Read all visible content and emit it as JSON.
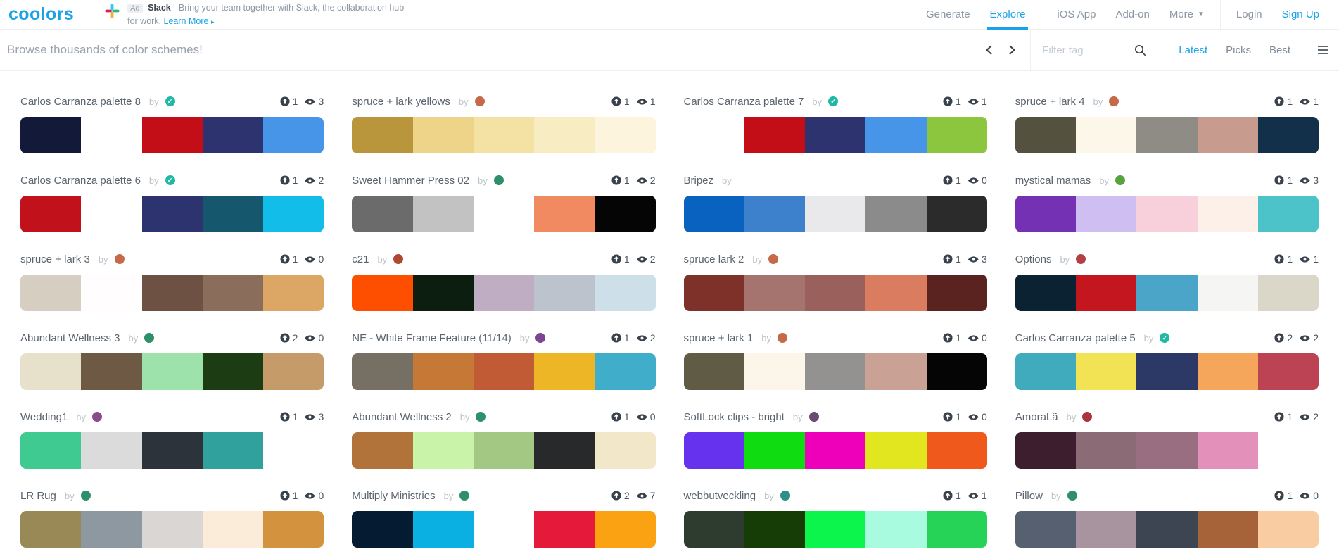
{
  "header": {
    "logo": "coolors",
    "ad": {
      "badge": "Ad",
      "brand": "Slack",
      "text1": "- Bring your team together with Slack, the collaboration hub",
      "text2": "for work.",
      "link_label": "Learn More",
      "link_arrow": "▸"
    },
    "nav": [
      {
        "label": "Generate"
      },
      {
        "label": "Explore",
        "active": true
      },
      {
        "label": "iOS App"
      },
      {
        "label": "Add-on"
      },
      {
        "label": "More",
        "has_caret": true
      },
      {
        "label": "Login"
      },
      {
        "label": "Sign Up",
        "highlight": true
      }
    ]
  },
  "toolbar": {
    "title": "Browse thousands of color schemes!",
    "filter_placeholder": "Filter tag",
    "tabs": [
      {
        "label": "Latest",
        "active": true
      },
      {
        "label": "Picks"
      },
      {
        "label": "Best"
      }
    ]
  },
  "shared": {
    "by_label": "by"
  },
  "icons": {
    "saves": "upload-icon",
    "views": "eye-icon",
    "search": "search-icon",
    "prev": "chevron-left-icon",
    "next": "chevron-right-icon",
    "menu": "hamburger-icon",
    "verified": "check-icon",
    "ad_logo": "slack-icon"
  },
  "colors": {
    "accent_blue": "#19A2E8",
    "verified_teal": "#1FB9A5",
    "icon_dark": "#39424B"
  },
  "palettes": [
    {
      "title": "Carlos Carranza palette 8",
      "verified": true,
      "avatar": "#1FB9A5",
      "saves": "1",
      "views": "3",
      "colors": [
        "#131A39",
        "#FFFFFF",
        "#C30E18",
        "#2D336E",
        "#4795E8"
      ]
    },
    {
      "title": "spruce + lark yellows",
      "verified": false,
      "avatar": "#C56A48",
      "saves": "1",
      "views": "1",
      "colors": [
        "#B9953C",
        "#EDD488",
        "#F3E2A4",
        "#F8ECC3",
        "#FCF4DD"
      ]
    },
    {
      "title": "Carlos Carranza palette 7",
      "verified": true,
      "avatar": "#1FB9A5",
      "saves": "1",
      "views": "1",
      "colors": [
        "#FFFFFF",
        "#C30E18",
        "#2D336E",
        "#4795E8",
        "#8CC63E"
      ]
    },
    {
      "title": "spruce + lark 4",
      "verified": false,
      "avatar": "#C56A48",
      "saves": "1",
      "views": "1",
      "colors": [
        "#55513F",
        "#FDF7EA",
        "#8F8C86",
        "#C79C8E",
        "#12304A"
      ]
    },
    {
      "title": "Carlos Carranza palette 6",
      "verified": true,
      "avatar": "#1FB9A5",
      "saves": "1",
      "views": "2",
      "colors": [
        "#C1121C",
        "#FFFFFF",
        "#2D336E",
        "#15586E",
        "#12BDEA"
      ]
    },
    {
      "title": "Sweet Hammer Press 02",
      "verified": false,
      "avatar": "#2F8F6B",
      "saves": "1",
      "views": "2",
      "colors": [
        "#6B6B6B",
        "#C2C2C2",
        "#FFFFFF",
        "#F18A60",
        "#050505"
      ]
    },
    {
      "title": "Bripez",
      "verified": false,
      "avatar": null,
      "saves": "1",
      "views": "0",
      "colors": [
        "#0A62C0",
        "#3D80CC",
        "#E9E9EB",
        "#8B8B8B",
        "#2B2B2B"
      ]
    },
    {
      "title": "mystical mamas",
      "verified": false,
      "avatar": "#58A23F",
      "saves": "1",
      "views": "3",
      "colors": [
        "#7431B4",
        "#CFBEF1",
        "#F7D0DC",
        "#FDF0E9",
        "#4BC3C9"
      ]
    },
    {
      "title": "spruce + lark 3",
      "verified": false,
      "avatar": "#C56A48",
      "saves": "1",
      "views": "0",
      "colors": [
        "#D5CEC1",
        "#FFFDFE",
        "#6D5244",
        "#8A6E5B",
        "#DCA765"
      ]
    },
    {
      "title": "c21",
      "verified": false,
      "avatar": "#B0482F",
      "saves": "1",
      "views": "2",
      "colors": [
        "#FE4F01",
        "#0C1E10",
        "#BFAEC3",
        "#BCC3CD",
        "#CDE0EA"
      ]
    },
    {
      "title": "spruce lark 2",
      "verified": false,
      "avatar": "#C56A48",
      "saves": "1",
      "views": "3",
      "colors": [
        "#7D3129",
        "#A6746F",
        "#99605C",
        "#DA7C60",
        "#5B2320"
      ]
    },
    {
      "title": "Options",
      "verified": false,
      "avatar": "#B34045",
      "saves": "1",
      "views": "1",
      "colors": [
        "#0A2232",
        "#C3161E",
        "#4AA5C8",
        "#F5F5F3",
        "#DAD7C8"
      ]
    },
    {
      "title": "Abundant Wellness 3",
      "verified": false,
      "avatar": "#2F8F6B",
      "saves": "2",
      "views": "0",
      "colors": [
        "#E7E1CB",
        "#6E5945",
        "#9EE2AB",
        "#1C3D13",
        "#C59B69"
      ]
    },
    {
      "title": "NE - White Frame Feature (11/14)",
      "verified": false,
      "avatar": "#7C4590",
      "saves": "1",
      "views": "2",
      "colors": [
        "#757063",
        "#C67936",
        "#C15B36",
        "#ECB626",
        "#40ADCA"
      ]
    },
    {
      "title": "spruce + lark 1",
      "verified": false,
      "avatar": "#C56A48",
      "saves": "1",
      "views": "0",
      "colors": [
        "#5F5B44",
        "#FCF5E9",
        "#949291",
        "#CAA295",
        "#050505"
      ]
    },
    {
      "title": "Carlos Carranza palette 5",
      "verified": true,
      "avatar": "#1FB9A5",
      "saves": "2",
      "views": "2",
      "colors": [
        "#40ABBD",
        "#F1E353",
        "#2C3966",
        "#F6A65B",
        "#BB4354"
      ]
    },
    {
      "title": "Wedding1",
      "verified": false,
      "avatar": "#8A4A8F",
      "saves": "1",
      "views": "3",
      "colors": [
        "#3ECA90",
        "#DBDBDB",
        "#2D333A",
        "#30A19C",
        "#FFFFFF"
      ]
    },
    {
      "title": "Abundant Wellness 2",
      "verified": false,
      "avatar": "#2F8F6B",
      "saves": "1",
      "views": "0",
      "colors": [
        "#B17339",
        "#CAF3AA",
        "#A2C884",
        "#27292A",
        "#F3E7C9"
      ]
    },
    {
      "title": "SoftLock clips - bright",
      "verified": false,
      "avatar": "#6B4B72",
      "saves": "1",
      "views": "0",
      "colors": [
        "#6732ED",
        "#10DC12",
        "#EE00BB",
        "#E1E61F",
        "#EF591B"
      ]
    },
    {
      "title": "AmoraLã",
      "verified": false,
      "avatar": "#A93440",
      "saves": "1",
      "views": "2",
      "colors": [
        "#3C1E2F",
        "#8B6C76",
        "#996E80",
        "#E390BA",
        "#FFFFFF"
      ]
    },
    {
      "title": "LR Rug",
      "verified": false,
      "avatar": "#2F8F6B",
      "saves": "1",
      "views": "0",
      "colors": [
        "#998957",
        "#8D98A0",
        "#DAD6D3",
        "#FBECDA",
        "#D3923E"
      ]
    },
    {
      "title": "Multiply Ministries",
      "verified": false,
      "avatar": "#2F8F6B",
      "saves": "2",
      "views": "7",
      "colors": [
        "#051B31",
        "#09B0E1",
        "#FEFFFE",
        "#E51A3B",
        "#FBA212"
      ]
    },
    {
      "title": "webbutveckling",
      "verified": false,
      "avatar": "#2E8F86",
      "saves": "1",
      "views": "1",
      "colors": [
        "#2D3C2E",
        "#163D06",
        "#0CF54C",
        "#A9FBE0",
        "#26D356"
      ]
    },
    {
      "title": "Pillow",
      "verified": false,
      "avatar": "#2F8F6B",
      "saves": "1",
      "views": "0",
      "colors": [
        "#566070",
        "#A8949F",
        "#3D4553",
        "#A66339",
        "#FACCA2"
      ]
    }
  ]
}
